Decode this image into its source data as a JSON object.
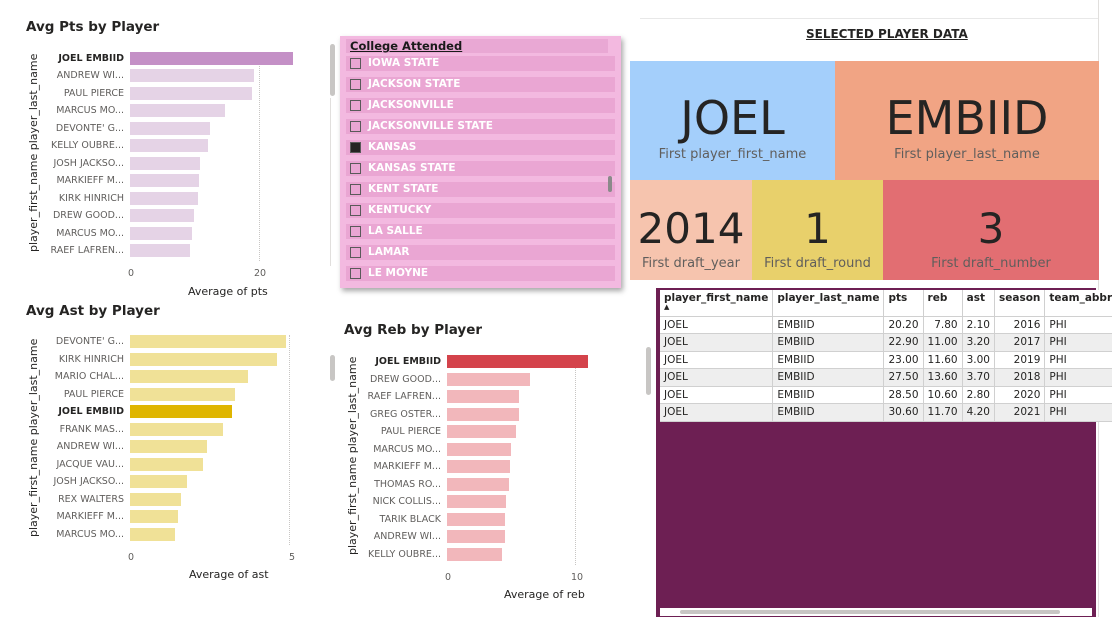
{
  "colors": {
    "pts_highlight": "#c490c6",
    "pts_bar": "#e5d3e6",
    "ast_highlight": "#dfb500",
    "ast_bar": "#f0e197",
    "reb_highlight": "#d4434b",
    "reb_bar": "#f2b7bb",
    "slicer_bg": "#f3b9e0",
    "card_first_name": "#a4cffb",
    "card_last_name": "#f1a484",
    "card_year": "#f6c4ae",
    "card_round": "#e8d06b",
    "card_number": "#e26e72",
    "table_bg": "#6d1f53"
  },
  "pts_chart": {
    "title": "Avg Pts by Player",
    "ylabel": "player_first_name player_last_name",
    "xlabel": "Average of pts",
    "ticks": [
      "0",
      "20"
    ]
  },
  "ast_chart": {
    "title": "Avg Ast by Player",
    "ylabel": "player_first_name player_last_name",
    "xlabel": "Average of ast",
    "ticks": [
      "0",
      "5"
    ]
  },
  "reb_chart": {
    "title": "Avg Reb by Player",
    "ylabel": "player_first_name player_last_name",
    "xlabel": "Average of reb",
    "ticks": [
      "0",
      "10"
    ]
  },
  "chart_data": [
    {
      "type": "bar",
      "orientation": "horizontal",
      "title": "Avg Pts by Player",
      "xlabel": "Average of pts",
      "ylabel": "player_first_name player_last_name",
      "xlim": [
        0,
        30
      ],
      "highlighted": "JOEL EMBIID",
      "categories": [
        "JOEL EMBIID",
        "ANDREW WI...",
        "PAUL PIERCE",
        "MARCUS MO...",
        "DEVONTE' G...",
        "KELLY OUBRE...",
        "JOSH JACKSO...",
        "MARKIEFF M...",
        "KIRK HINRICH",
        "DREW GOOD...",
        "MARCUS MO...",
        "RAEF LAFREN..."
      ],
      "values": [
        25.4,
        19.3,
        19.0,
        14.8,
        12.4,
        12.2,
        10.9,
        10.7,
        10.5,
        10.0,
        9.7,
        9.3
      ]
    },
    {
      "type": "bar",
      "orientation": "horizontal",
      "title": "Avg Ast by Player",
      "xlabel": "Average of ast",
      "ylabel": "player_first_name player_last_name",
      "xlim": [
        0,
        5.8
      ],
      "highlighted": "JOEL EMBIID",
      "categories": [
        "DEVONTE' G...",
        "KIRK HINRICH",
        "MARIO CHAL...",
        "PAUL PIERCE",
        "JOEL EMBIID",
        "FRANK MAS...",
        "ANDREW WI...",
        "JACQUE VAU...",
        "JOSH JACKSO...",
        "REX WALTERS",
        "MARKIEFF M...",
        "MARCUS MO..."
      ],
      "values": [
        4.9,
        4.6,
        3.7,
        3.3,
        3.2,
        2.9,
        2.4,
        2.3,
        1.8,
        1.6,
        1.5,
        1.4
      ]
    },
    {
      "type": "bar",
      "orientation": "horizontal",
      "title": "Avg Reb by Player",
      "xlabel": "Average of reb",
      "ylabel": "player_first_name player_last_name",
      "xlim": [
        0,
        12
      ],
      "highlighted": "JOEL EMBIID",
      "categories": [
        "JOEL EMBIID",
        "DREW GOOD...",
        "RAEF LAFREN...",
        "GREG OSTER...",
        "PAUL PIERCE",
        "MARCUS MO...",
        "MARKIEFF M...",
        "THOMAS RO...",
        "NICK COLLIS...",
        "TARIK BLACK",
        "ANDREW WI...",
        "KELLY OUBRE..."
      ],
      "values": [
        11.0,
        6.5,
        5.6,
        5.6,
        5.4,
        5.0,
        4.9,
        4.8,
        4.6,
        4.5,
        4.5,
        4.3
      ]
    }
  ],
  "slicer": {
    "header": "College Attended",
    "items": [
      {
        "label": "IOWA STATE",
        "checked": false
      },
      {
        "label": "JACKSON STATE",
        "checked": false
      },
      {
        "label": "JACKSONVILLE",
        "checked": false
      },
      {
        "label": "JACKSONVILLE STATE",
        "checked": false
      },
      {
        "label": "KANSAS",
        "checked": true
      },
      {
        "label": "KANSAS STATE",
        "checked": false
      },
      {
        "label": "KENT STATE",
        "checked": false
      },
      {
        "label": "KENTUCKY",
        "checked": false
      },
      {
        "label": "LA SALLE",
        "checked": false
      },
      {
        "label": "LAMAR",
        "checked": false
      },
      {
        "label": "LE MOYNE",
        "checked": false
      }
    ]
  },
  "selected_header": "SELECTED PLAYER DATA",
  "cards": {
    "first_name": {
      "value": "JOEL",
      "label": "First player_first_name"
    },
    "last_name": {
      "value": "EMBIID",
      "label": "First player_last_name"
    },
    "draft_year": {
      "value": "2014",
      "label": "First draft_year"
    },
    "draft_round": {
      "value": "1",
      "label": "First draft_round"
    },
    "draft_number": {
      "value": "3",
      "label": "First draft_number"
    }
  },
  "table": {
    "columns": [
      "player_first_name",
      "player_last_name",
      "pts",
      "reb",
      "ast",
      "season",
      "team_abbreviat"
    ],
    "sort_column": "player_first_name",
    "rows": [
      [
        "JOEL",
        "EMBIID",
        "20.20",
        "7.80",
        "2.10",
        "2016",
        "PHI"
      ],
      [
        "JOEL",
        "EMBIID",
        "22.90",
        "11.00",
        "3.20",
        "2017",
        "PHI"
      ],
      [
        "JOEL",
        "EMBIID",
        "23.00",
        "11.60",
        "3.00",
        "2019",
        "PHI"
      ],
      [
        "JOEL",
        "EMBIID",
        "27.50",
        "13.60",
        "3.70",
        "2018",
        "PHI"
      ],
      [
        "JOEL",
        "EMBIID",
        "28.50",
        "10.60",
        "2.80",
        "2020",
        "PHI"
      ],
      [
        "JOEL",
        "EMBIID",
        "30.60",
        "11.70",
        "4.20",
        "2021",
        "PHI"
      ]
    ]
  }
}
